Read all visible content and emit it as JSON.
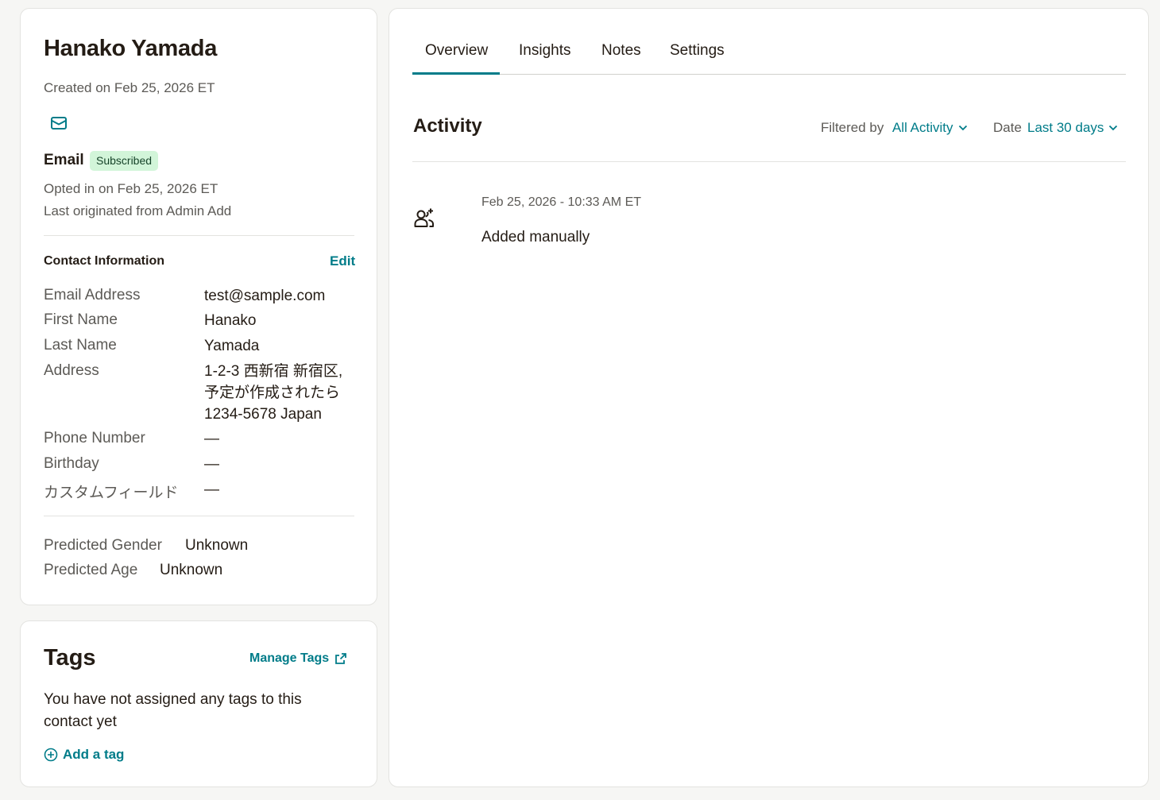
{
  "colors": {
    "accent": "#007c89",
    "badge_bg": "#d2f5d9",
    "text": "#241c15",
    "muted_text": "#5c5a56",
    "page_bg": "#f6f6f4"
  },
  "profile": {
    "name": "Hanako Yamada",
    "created_on": "Created on Feb 25, 2026 ET",
    "channel_icon": "mail-icon",
    "email_label": "Email",
    "status_badge": "Subscribed",
    "opted_in": "Opted in on Feb 25, 2026 ET",
    "last_originated": "Last originated from Admin Add"
  },
  "contact_info": {
    "title": "Contact Information",
    "edit_label": "Edit",
    "fields": [
      {
        "label": "Email Address",
        "value": [
          "test@sample.com"
        ]
      },
      {
        "label": "First Name",
        "value": [
          "Hanako"
        ]
      },
      {
        "label": "Last Name",
        "value": [
          "Yamada"
        ]
      },
      {
        "label": "Address",
        "value": [
          "1-2-3 西新宿 新宿区,",
          "予定が作成されたら",
          "1234-5678 Japan"
        ]
      },
      {
        "label": "Phone Number",
        "value": [
          "—"
        ]
      },
      {
        "label": "Birthday",
        "value": [
          "—"
        ]
      },
      {
        "label": "カスタムフィールド",
        "value": [
          "—"
        ]
      }
    ]
  },
  "predictions": {
    "gender_label": "Predicted Gender",
    "gender_value": "Unknown",
    "age_label": "Predicted Age",
    "age_value": "Unknown"
  },
  "tags": {
    "title": "Tags",
    "manage_label": "Manage Tags",
    "manage_icon": "external-link-icon",
    "empty_message": "You have not assigned any tags to this contact yet",
    "add_label": "Add a tag",
    "add_icon": "plus-circle-icon"
  },
  "tabs": [
    {
      "label": "Overview",
      "active": true
    },
    {
      "label": "Insights",
      "active": false
    },
    {
      "label": "Notes",
      "active": false
    },
    {
      "label": "Settings",
      "active": false
    }
  ],
  "activity": {
    "title": "Activity",
    "filter_label": "Filtered by",
    "filter_value": "All Activity",
    "date_label": "Date",
    "date_value": "Last 30 days",
    "events": [
      {
        "icon": "add-user-icon",
        "time": "Feb 25, 2026 - 10:33 AM ET",
        "text": "Added manually"
      }
    ]
  }
}
